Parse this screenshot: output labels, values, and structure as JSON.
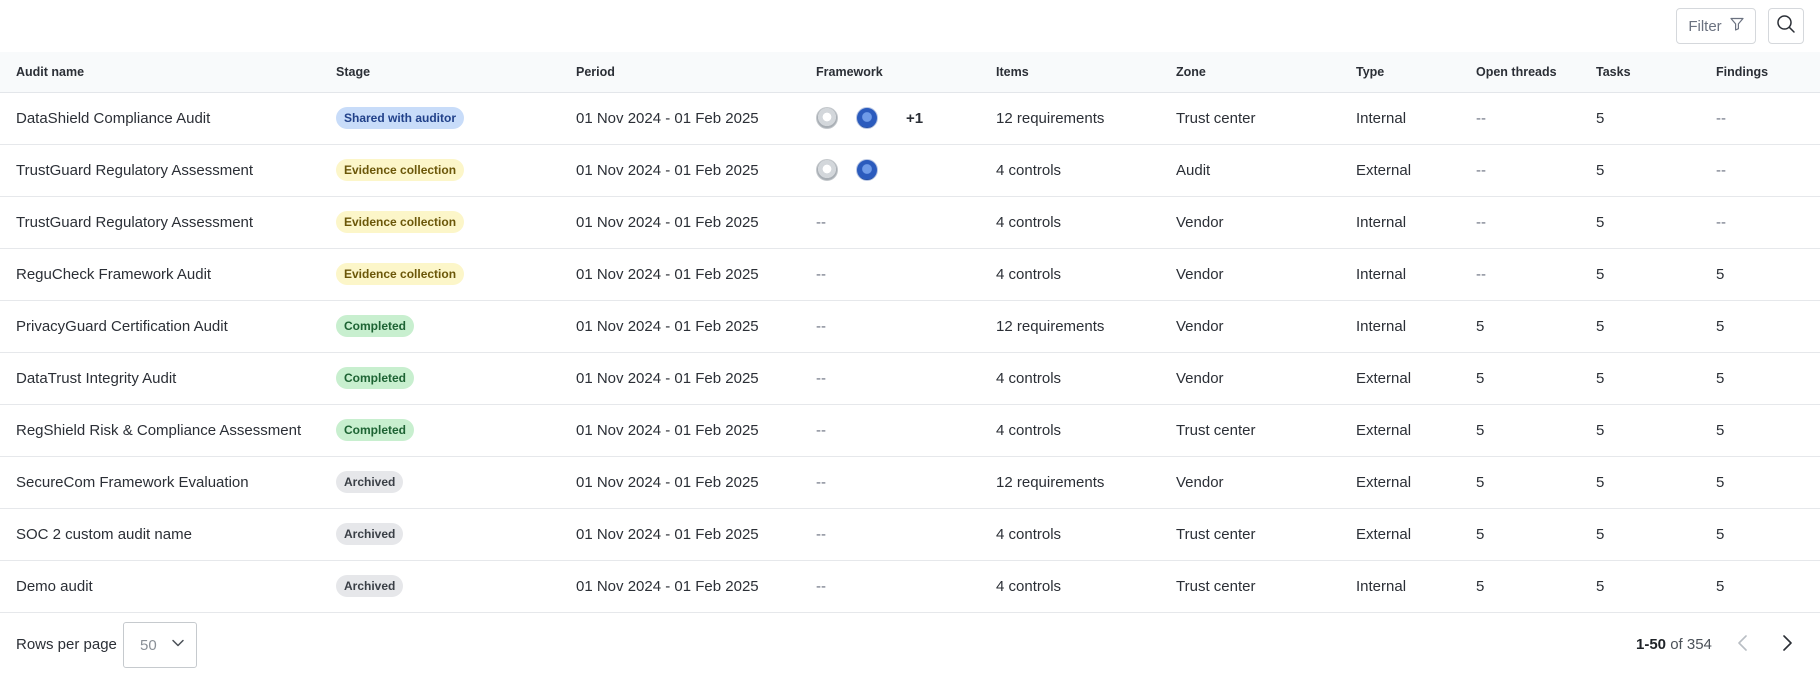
{
  "toolbar": {
    "filter_label": "Filter",
    "filter_icon": "funnel-icon",
    "search_icon": "search-icon"
  },
  "table": {
    "columns": [
      "Audit name",
      "Stage",
      "Period",
      "Framework",
      "Items",
      "Zone",
      "Type",
      "Open threads",
      "Tasks",
      "Findings"
    ],
    "rows": [
      {
        "name": "DataShield Compliance Audit",
        "stage": "Shared with auditor",
        "stage_color": "blue",
        "period": "01 Nov 2024 - 01 Feb 2025",
        "framework": {
          "icons": [
            "silver-seal-icon",
            "blue-globe-icon"
          ],
          "more": "+1"
        },
        "items": "12 requirements",
        "zone": "Trust center",
        "type": "Internal",
        "open_threads": "--",
        "tasks": "5",
        "findings": "--"
      },
      {
        "name": "TrustGuard Regulatory Assessment",
        "stage": "Evidence collection",
        "stage_color": "yellow",
        "period": "01 Nov 2024 - 01 Feb 2025",
        "framework": {
          "icons": [
            "silver-seal-icon",
            "blue-globe-icon"
          ],
          "more": ""
        },
        "items": "4 controls",
        "zone": "Audit",
        "type": "External",
        "open_threads": "--",
        "tasks": "5",
        "findings": "--"
      },
      {
        "name": "TrustGuard Regulatory Assessment",
        "stage": "Evidence collection",
        "stage_color": "yellow",
        "period": "01 Nov 2024 - 01 Feb 2025",
        "framework": {
          "text": "--"
        },
        "items": "4 controls",
        "zone": "Vendor",
        "type": "Internal",
        "open_threads": "--",
        "tasks": "5",
        "findings": "--"
      },
      {
        "name": "ReguCheck Framework Audit",
        "stage": "Evidence collection",
        "stage_color": "yellow",
        "period": "01 Nov 2024 - 01 Feb 2025",
        "framework": {
          "text": "--"
        },
        "items": "4 controls",
        "zone": "Vendor",
        "type": "Internal",
        "open_threads": "--",
        "tasks": "5",
        "findings": "5"
      },
      {
        "name": "PrivacyGuard Certification Audit",
        "stage": "Completed",
        "stage_color": "green",
        "period": "01 Nov 2024 - 01 Feb 2025",
        "framework": {
          "text": "--"
        },
        "items": "12 requirements",
        "zone": "Vendor",
        "type": "Internal",
        "open_threads": "5",
        "tasks": "5",
        "findings": "5"
      },
      {
        "name": "DataTrust Integrity Audit",
        "stage": "Completed",
        "stage_color": "green",
        "period": "01 Nov 2024 - 01 Feb 2025",
        "framework": {
          "text": "--"
        },
        "items": "4 controls",
        "zone": "Vendor",
        "type": "External",
        "open_threads": "5",
        "tasks": "5",
        "findings": "5"
      },
      {
        "name": " RegShield Risk & Compliance Assessment",
        "stage": "Completed",
        "stage_color": "green",
        "period": "01 Nov 2024 - 01 Feb 2025",
        "framework": {
          "text": "--"
        },
        "items": "4 controls",
        "zone": "Trust center",
        "type": "External",
        "open_threads": "5",
        "tasks": "5",
        "findings": "5"
      },
      {
        "name": "SecureCom Framework Evaluation",
        "stage": "Archived",
        "stage_color": "gray",
        "period": "01 Nov 2024 - 01 Feb 2025",
        "framework": {
          "text": "--"
        },
        "items": "12 requirements",
        "zone": "Vendor",
        "type": "External",
        "open_threads": "5",
        "tasks": "5",
        "findings": "5"
      },
      {
        "name": "SOC 2 custom audit name",
        "stage": "Archived",
        "stage_color": "gray",
        "period": "01 Nov 2024 - 01 Feb 2025",
        "framework": {
          "text": "--"
        },
        "items": "4 controls",
        "zone": "Trust center",
        "type": "External",
        "open_threads": "5",
        "tasks": "5",
        "findings": "5"
      },
      {
        "name": "Demo audit",
        "stage": "Archived",
        "stage_color": "gray",
        "period": "01 Nov 2024 - 01 Feb 2025",
        "framework": {
          "text": "--"
        },
        "items": "4 controls",
        "zone": "Trust center",
        "type": "Internal",
        "open_threads": "5",
        "tasks": "5",
        "findings": "5"
      }
    ]
  },
  "footer": {
    "rows_per_page_label": "Rows per page",
    "rows_per_page_value": "50",
    "range_bold": "1-50",
    "range_rest": " of 354"
  }
}
